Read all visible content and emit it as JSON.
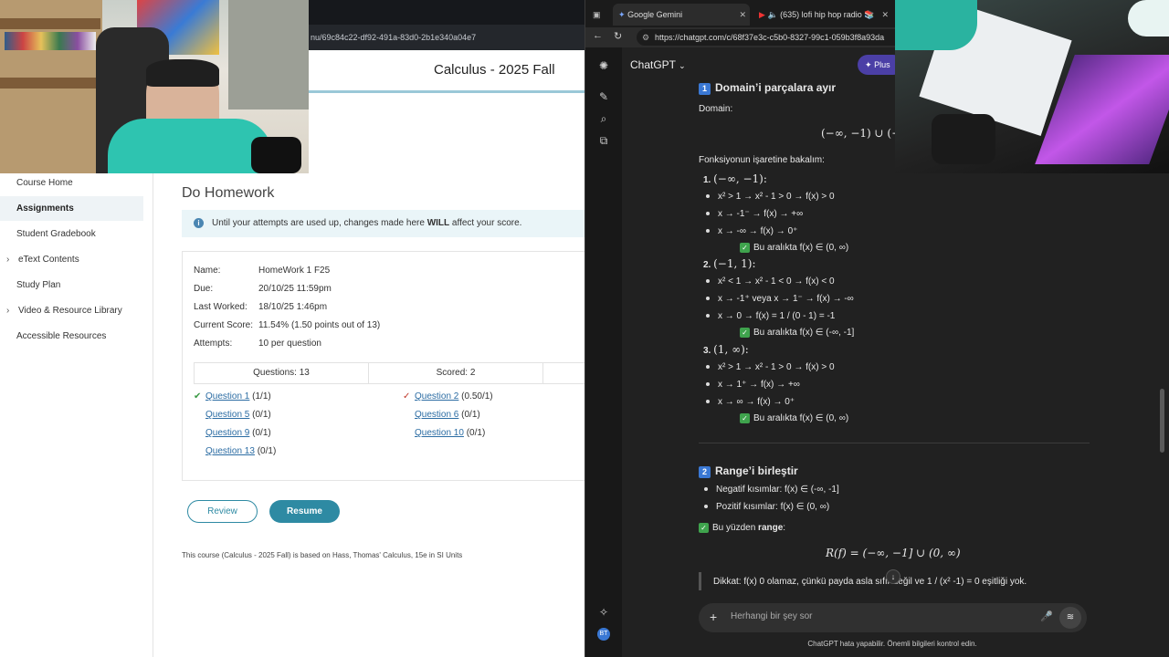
{
  "lms": {
    "url_fragment": "nu/69c84c22-df92-491a-83d0-2b1e340a04e7",
    "course_title": "Calculus - 2025 Fall",
    "sidebar": [
      {
        "label": "Course Home",
        "chevron": false,
        "active": false
      },
      {
        "label": "Assignments",
        "chevron": false,
        "active": true
      },
      {
        "label": "Student Gradebook",
        "chevron": false,
        "active": false
      },
      {
        "label": "eText Contents",
        "chevron": true,
        "active": false
      },
      {
        "label": "Study Plan",
        "chevron": false,
        "active": false
      },
      {
        "label": "Video & Resource Library",
        "chevron": true,
        "active": false
      },
      {
        "label": "Accessible Resources",
        "chevron": false,
        "active": false
      }
    ],
    "page_title": "Do Homework",
    "notice_prefix": "Until your attempts are used up, changes made here ",
    "notice_bold": "WILL",
    "notice_suffix": " affect your score.",
    "info": {
      "name_label": "Name:",
      "name": "HomeWork 1 F25",
      "due_label": "Due:",
      "due": "20/10/25 11:59pm",
      "last_label": "Last Worked:",
      "last": "18/10/25 1:46pm",
      "score_label": "Current Score:",
      "score": "11.54% (1.50 points out of 13)",
      "attempts_label": "Attempts:",
      "attempts": "10 per question"
    },
    "table_header": {
      "questions": "Questions: 13",
      "scored": "Scored: 2"
    },
    "questions": [
      {
        "link": "Question 1",
        "score": "(1/1)",
        "mark": "✔"
      },
      {
        "link": "Question 2",
        "score": "(0.50/1)",
        "mark": "✓"
      },
      {
        "link": "Question 5",
        "score": "(0/1)",
        "mark": ""
      },
      {
        "link": "Question 6",
        "score": "(0/1)",
        "mark": ""
      },
      {
        "link": "Question 9",
        "score": "(0/1)",
        "mark": ""
      },
      {
        "link": "Question 10",
        "score": "(0/1)",
        "mark": ""
      },
      {
        "link": "Question 13",
        "score": "(0/1)",
        "mark": ""
      }
    ],
    "buttons": {
      "review": "Review",
      "resume": "Resume"
    },
    "course_note": "This course (Calculus - 2025 Fall) is based on Hass, Thomas' Calculus, 15e in SI Units"
  },
  "browser": {
    "tabs": [
      {
        "label": "Google Gemini",
        "icon": "gemini-icon"
      },
      {
        "label": "(635) lofi hip hop radio 📚",
        "icon": "youtube-icon"
      }
    ],
    "url": "https://chatgpt.com/c/68f37e3c-c5b0-8327-99c1-059b3f8a93da"
  },
  "chatgpt": {
    "title": "ChatGPT",
    "plus_label": "Plus",
    "section1_num": "1",
    "section1_title": "Domain’i parçalara ayır",
    "domain_label": "Domain:",
    "domain_math": "(−∞, −1) ∪ (−",
    "sign_intro": "Fonksiyonun işaretine bakalım:",
    "interval1": {
      "num": "1.",
      "label": "(−∞, −1):",
      "lines": [
        "x² > 1 → x² - 1 > 0 → f(x) > 0",
        "x → -1⁻ → f(x) → +∞",
        "x → -∞ → f(x) → 0⁺"
      ],
      "conclusion": "Bu aralıkta f(x) ∈ (0, ∞)"
    },
    "interval2": {
      "num": "2.",
      "label": "(−1, 1):",
      "lines": [
        "x² < 1 → x² - 1 < 0 → f(x) < 0",
        "x → -1⁺ veya x → 1⁻ → f(x) → -∞",
        "x → 0 → f(x) = 1 / (0 - 1) = -1"
      ],
      "conclusion": "Bu aralıkta f(x) ∈ (-∞, -1]"
    },
    "interval3": {
      "num": "3.",
      "label": "(1, ∞):",
      "lines": [
        "x² > 1 → x² - 1 > 0 → f(x) > 0",
        "x → 1⁺ → f(x) → +∞",
        "x → ∞ → f(x) → 0⁺"
      ],
      "conclusion": "Bu aralıkta f(x) ∈ (0, ∞)"
    },
    "section2_num": "2",
    "section2_title": "Range’i birleştir",
    "neg_line": "Negatif kısımlar: f(x) ∈ (-∞, -1]",
    "pos_line": "Pozitif kısımlar: f(x) ∈ (0, ∞)",
    "therefore_prefix": "Bu yüzden ",
    "therefore_bold": "range",
    "therefore_suffix": ":",
    "range_math": "R(f) = (−∞, −1] ∪ (0, ∞)",
    "note": "Dikkat: f(x) 0 olamaz, çünkü payda asla sıfır değil ve 1 / (x² -1) = 0 eşitliği yok.",
    "composer_placeholder": "Herhangi bir şey sor",
    "footer": "ChatGPT hata yapabilir. Önemli bilgileri kontrol edin.",
    "avatar": "BT"
  },
  "colors": {
    "accent_teal": "#2e8aa3",
    "link_blue": "#2b6ca3",
    "plus_purple": "#4b3fa6",
    "check_green": "#3fa34d"
  }
}
